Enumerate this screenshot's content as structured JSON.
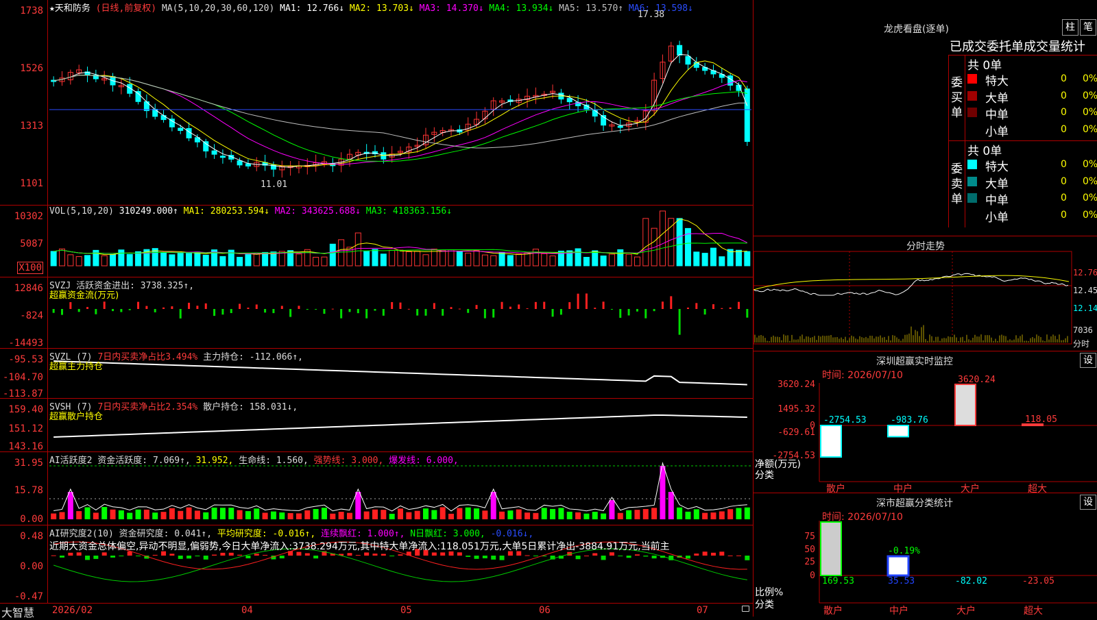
{
  "main": {
    "title": "★天和防务",
    "period": "(日线,前复权)",
    "ma_label": "MA(5,10,20,30,60,120)",
    "ma": [
      {
        "label": "MA1: 12.766↓",
        "color": "#ffffff"
      },
      {
        "label": "MA2: 13.703↓",
        "color": "#ffff00"
      },
      {
        "label": "MA3: 14.370↓",
        "color": "#ff00ff"
      },
      {
        "label": "MA4: 13.934↓",
        "color": "#00ff00"
      },
      {
        "label": "MA5: 13.570↑",
        "color": "#c0c0c0"
      },
      {
        "label": "MA6: 13.598↓",
        "color": "#0000ff"
      }
    ],
    "yticks": [
      "1738",
      "1526",
      "1313",
      "1101"
    ],
    "high_mark": "17.38",
    "low_mark": "11.01"
  },
  "vol": {
    "label": "VOL(5,10,20)",
    "value": "310249.000↑",
    "ma": [
      {
        "label": "MA1: 280253.594↓",
        "color": "#ffff00"
      },
      {
        "label": "MA2: 343625.688↓",
        "color": "#ff00ff"
      },
      {
        "label": "MA3: 418363.156↓",
        "color": "#00ff00"
      }
    ],
    "yticks": [
      "10302",
      "5087",
      "X100"
    ]
  },
  "svzj": {
    "label": "SVZJ  活跃资金进出: 3738.325↑,",
    "sub": "超赢资金流(万元)",
    "yticks": [
      "12846",
      "-824",
      "-14493"
    ]
  },
  "svzl": {
    "label": "SVZL (7)",
    "part1": "7日内买卖净占比3.494%",
    "part2": "主力持仓: -112.066↑,",
    "sub": "超赢主力持仓",
    "yticks": [
      "-95.53",
      "-104.70",
      "-113.87"
    ]
  },
  "svsh": {
    "label": "SVSH (7)",
    "part1": "7日内买卖净占比2.354%",
    "part2": "散户持仓: 158.031↓,",
    "sub": "超赢散户持仓",
    "yticks": [
      "159.40",
      "151.12",
      "143.16"
    ]
  },
  "ai1": {
    "label": "AI活跃度2 资金活跃度: 7.069↑,",
    "v2": "31.952,",
    "v3": "生命线: 1.560,",
    "v4": "强势线: 3.000,",
    "v5": "爆发线: 6.000,",
    "yticks": [
      "31.95",
      "15.78",
      "0.00"
    ]
  },
  "ai2": {
    "label": "AI研究度2(10) 资金研究度: 0.041↑,",
    "v2": "平均研究度: -0.016↑,",
    "v3": "连续飘红: 1.000↑,",
    "v4": "N日飘红: 3.000,",
    "v5": "-0.016↓,",
    "note": "近期大资金总体偏空,异动不明显,偏弱势,今日大单净流入:3738.294万元,其中特大单净流入:118.051万元,大单5日累计净出-3884.91万元,当前主",
    "yticks": [
      "0.48",
      "0.00",
      "-0.47"
    ]
  },
  "xaxis": {
    "brand": "大智慧",
    "labels": [
      "2026/02",
      "04",
      "05",
      "06",
      "07"
    ]
  },
  "right": {
    "lhkp": {
      "title": "龙虎看盘(逐单)",
      "btn1": "柱",
      "btn2": "笔"
    },
    "stats_title": "已成交委托单成交量统计",
    "buy": {
      "side": "委买单",
      "total": "共 0单",
      "rows": [
        {
          "name": "特大",
          "v": "0",
          "p": "0%",
          "color": "#ff0000"
        },
        {
          "name": "大单",
          "v": "0",
          "p": "0%",
          "color": "#a00000"
        },
        {
          "name": "中单",
          "v": "0",
          "p": "0%",
          "color": "#700000"
        },
        {
          "name": "小单",
          "v": "0",
          "p": "0%",
          "color": "#000000"
        }
      ]
    },
    "sell": {
      "side": "委卖单",
      "total": "共 0单",
      "rows": [
        {
          "name": "特大",
          "v": "0",
          "p": "0%",
          "color": "#00ffff"
        },
        {
          "name": "大单",
          "v": "0",
          "p": "0%",
          "color": "#008b8b"
        },
        {
          "name": "中单",
          "v": "0",
          "p": "0%",
          "color": "#006c6c"
        },
        {
          "name": "小单",
          "v": "0",
          "p": "0%",
          "color": "#000000"
        }
      ]
    },
    "fenshi": {
      "title": "分时走势",
      "yticks": [
        "12.76",
        "12.45",
        "12.14"
      ],
      "vol": "7036",
      "unit": "分时"
    },
    "sz1": {
      "title": "深圳超赢实时监控",
      "btn": "设",
      "time": "时间: 2026/07/10",
      "yticks": [
        "3620.24",
        "1495.32",
        "0",
        "-629.61",
        "-2754.53"
      ],
      "axis_title": "净额(万元)",
      "axis_sub": "分类",
      "cats": [
        "散户",
        "中户",
        "大户",
        "超大"
      ],
      "values": [
        "-2754.53",
        "-983.76",
        "3620.24",
        "118.05"
      ]
    },
    "sz2": {
      "title": "深市超赢分类统计",
      "btn": "设",
      "time": "时间: 2026/07/10",
      "yticks": [
        "75",
        "50",
        "25",
        "0"
      ],
      "axis_title": "比例%",
      "axis_sub": "分类",
      "cats": [
        "散户",
        "中户",
        "大户",
        "超大"
      ],
      "values": [
        "169.53",
        "35.53",
        "-82.02",
        "-23.05"
      ],
      "mid_label": "-0.19%"
    }
  }
}
